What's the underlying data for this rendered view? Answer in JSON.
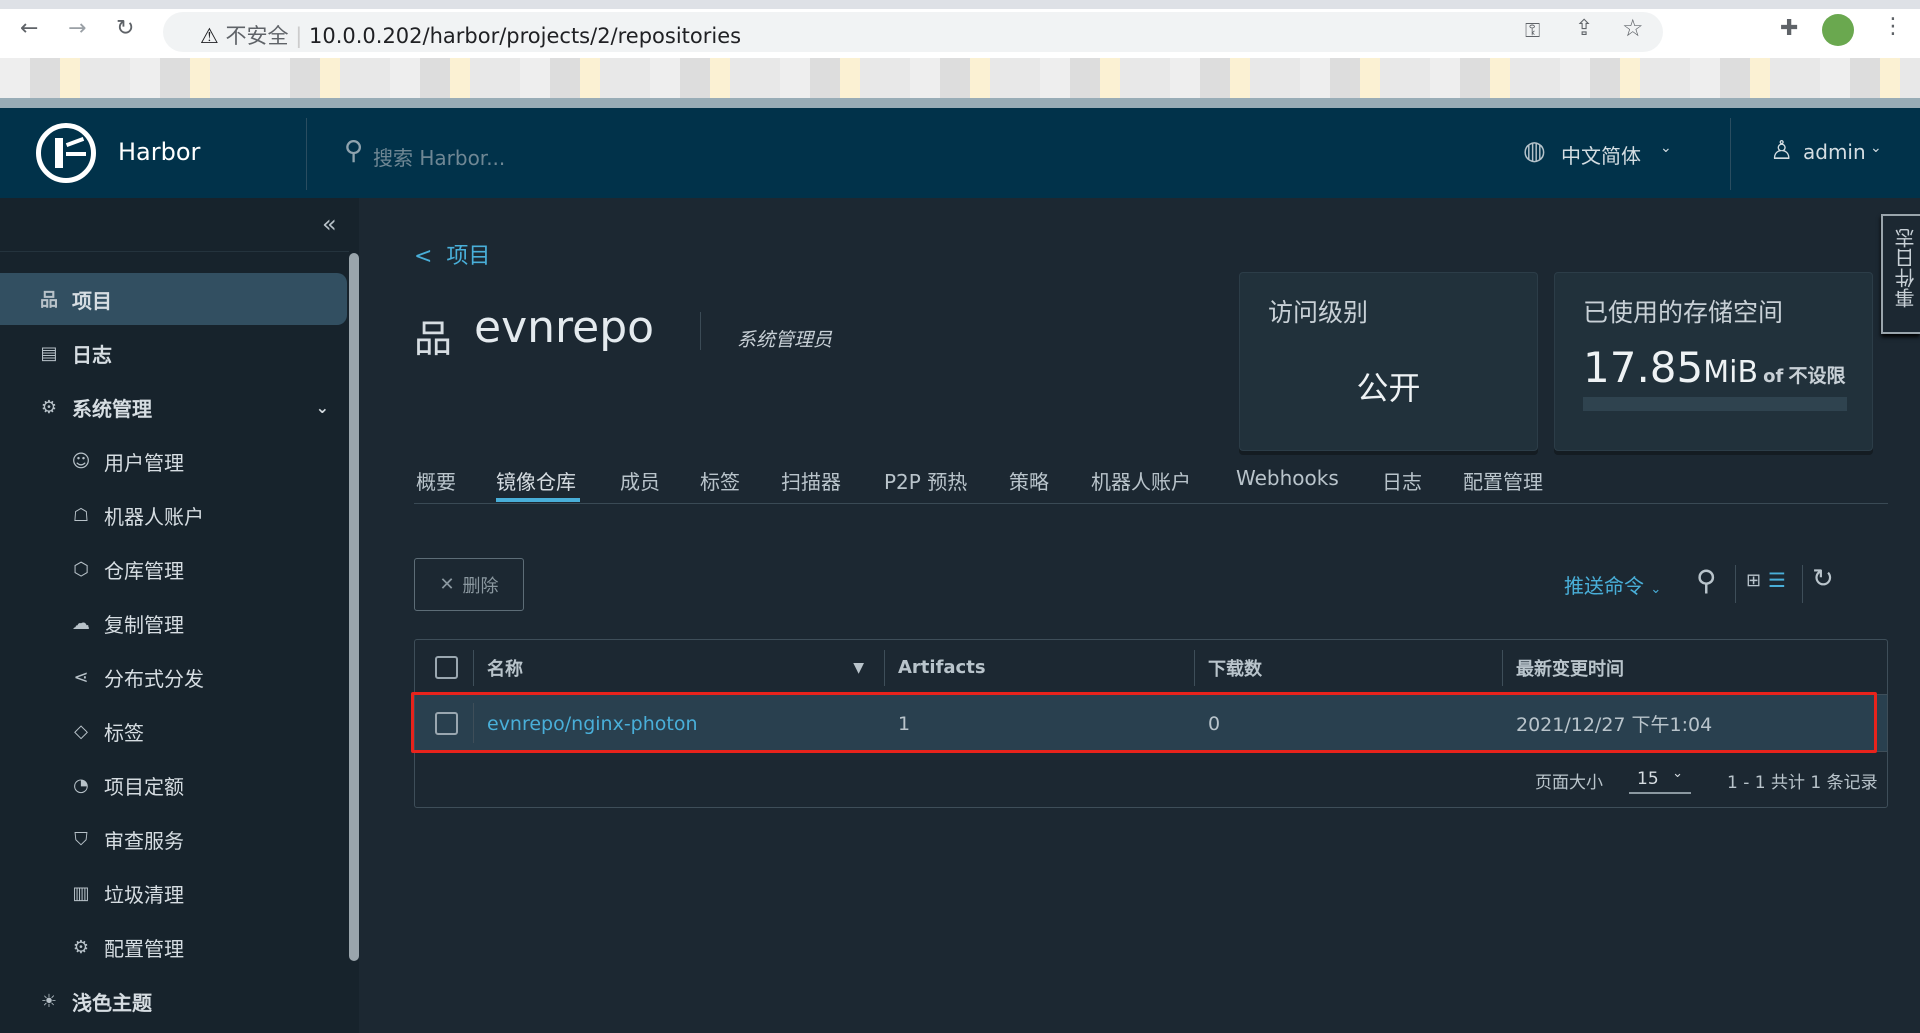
{
  "browser": {
    "insecure_label": "不安全",
    "url": "10.0.0.202/harbor/projects/2/repositories"
  },
  "header": {
    "brand": "Harbor",
    "search_placeholder": "搜索 Harbor...",
    "language": "中文简体",
    "user": "admin"
  },
  "sidebar": {
    "items": [
      {
        "label": "项目",
        "icon": "project-icon",
        "active": true,
        "level": "top"
      },
      {
        "label": "日志",
        "icon": "log-icon",
        "level": "top"
      },
      {
        "label": "系统管理",
        "icon": "admin-icon",
        "level": "top"
      },
      {
        "label": "用户管理",
        "icon": "users-icon",
        "level": "sub"
      },
      {
        "label": "机器人账户",
        "icon": "robot-icon",
        "level": "sub"
      },
      {
        "label": "仓库管理",
        "icon": "box-icon",
        "level": "sub"
      },
      {
        "label": "复制管理",
        "icon": "cloud-icon",
        "level": "sub"
      },
      {
        "label": "分布式分发",
        "icon": "share-icon",
        "level": "sub"
      },
      {
        "label": "标签",
        "icon": "tag-icon",
        "level": "sub"
      },
      {
        "label": "项目定额",
        "icon": "quota-icon",
        "level": "sub"
      },
      {
        "label": "审查服务",
        "icon": "shield-icon",
        "level": "sub"
      },
      {
        "label": "垃圾清理",
        "icon": "trash-icon",
        "level": "sub"
      },
      {
        "label": "配置管理",
        "icon": "gear-icon",
        "level": "sub"
      }
    ],
    "theme_toggle": "浅色主题"
  },
  "page": {
    "back_link": "项目",
    "project_name": "evnrepo",
    "role": "系统管理员"
  },
  "cards": {
    "access_title": "访问级别",
    "access_value": "公开",
    "storage_title": "已使用的存储空间",
    "storage_value": "17.85",
    "storage_unit": "MiB",
    "storage_of": "of",
    "storage_limit": "不设限",
    "storage_fraction": 0
  },
  "event_log": "事件日志",
  "tabs": [
    "概要",
    "镜像仓库",
    "成员",
    "标签",
    "扫描器",
    "P2P 预热",
    "策略",
    "机器人账户",
    "Webhooks",
    "日志",
    "配置管理"
  ],
  "active_tab": "镜像仓库",
  "toolbar": {
    "delete": "删除",
    "push_command": "推送命令"
  },
  "table": {
    "columns": [
      "名称",
      "Artifacts",
      "下载数",
      "最新变更时间"
    ],
    "rows": [
      {
        "name": "evnrepo/nginx-photon",
        "artifacts": "1",
        "downloads": "0",
        "updated": "2021/12/27 下午1:04"
      }
    ],
    "page_size_label": "页面大小",
    "page_size": "15",
    "summary": "1 - 1 共计 1 条记录"
  },
  "colors": {
    "header": "#01324a",
    "accent": "#49afd9",
    "highlight": "#e8231c"
  }
}
